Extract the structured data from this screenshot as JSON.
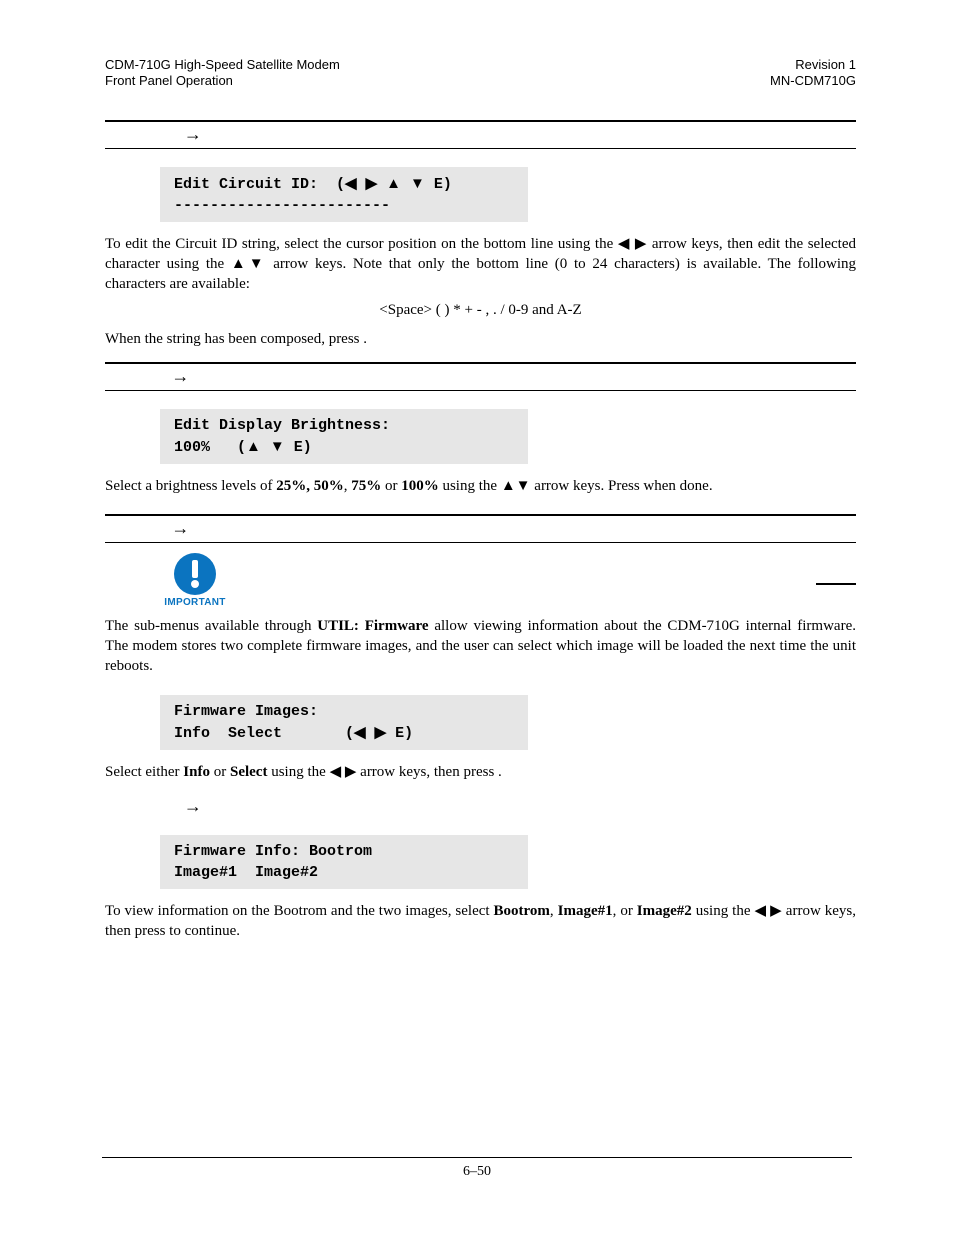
{
  "header": {
    "left_line1": "CDM-710G High-Speed Satellite Modem",
    "left_line2": "Front Panel Operation",
    "right_line1": "Revision 1",
    "right_line2": "MN-CDM710G"
  },
  "glyphs": {
    "arrow_right": "→",
    "tri_left": "◀",
    "tri_right": "▶",
    "tri_up": "▲",
    "tri_down": "▼"
  },
  "sec1": {
    "lcd_line1_a": "Edit Circuit ID:  (",
    "lcd_line1_b": " E)",
    "lcd_line2": "------------------------",
    "p1_a": "To edit the Circuit ID string, select the cursor position on the bottom line using the ",
    "p1_b": " arrow keys, then edit the selected character using the ",
    "p1_c": " arrow keys. Note that only the bottom line (0 to 24 characters) is available. The following characters are available:",
    "chars": "<Space>  ( )  *  +  -  ,  . /  0-9  and A-Z",
    "p2": "When the string has been composed, press          ."
  },
  "sec2": {
    "lcd_line1": "Edit Display Brightness:",
    "lcd_line2_a": "100%   (",
    "lcd_line2_b": " E)",
    "p_a": "Select a brightness levels of ",
    "b1": "25%, 50%",
    "comma": ", ",
    "b2": "75%",
    "or": " or ",
    "b3": "100%",
    "p_b": " using the ",
    "p_c": " arrow keys. Press           when done."
  },
  "sec3": {
    "important_label": "IMPORTANT",
    "p1_a": "The sub-menus available through ",
    "p1_bold": "UTIL: Firmware",
    "p1_b": " allow viewing information about the CDM-710G  internal firmware. The modem stores two complete firmware images, and the user can select which image will be loaded the next time the unit reboots.",
    "lcd1_line1": "Firmware Images:",
    "lcd1_line2_a": "Info  Select       (",
    "lcd1_line2_b": " E)",
    "p2_a": "Select either ",
    "p2_b1": "Info",
    "p2_or": " or ",
    "p2_b2": "Select",
    "p2_b": " using the  ",
    "p2_c": " arrow keys, then press             .",
    "lcd2_line1": "Firmware Info: Bootrom",
    "lcd2_line2": "Image#1  Image#2",
    "p3_a": "To view information on the Bootrom and the two images, select ",
    "p3_b1": "Bootrom",
    "p3_c1": ", ",
    "p3_b2": "Image#1",
    "p3_c2": ", or ",
    "p3_b3": "Image#2",
    "p3_b": " using the ",
    "p3_c": " arrow keys, then press              to continue."
  },
  "page_number": "6–50"
}
